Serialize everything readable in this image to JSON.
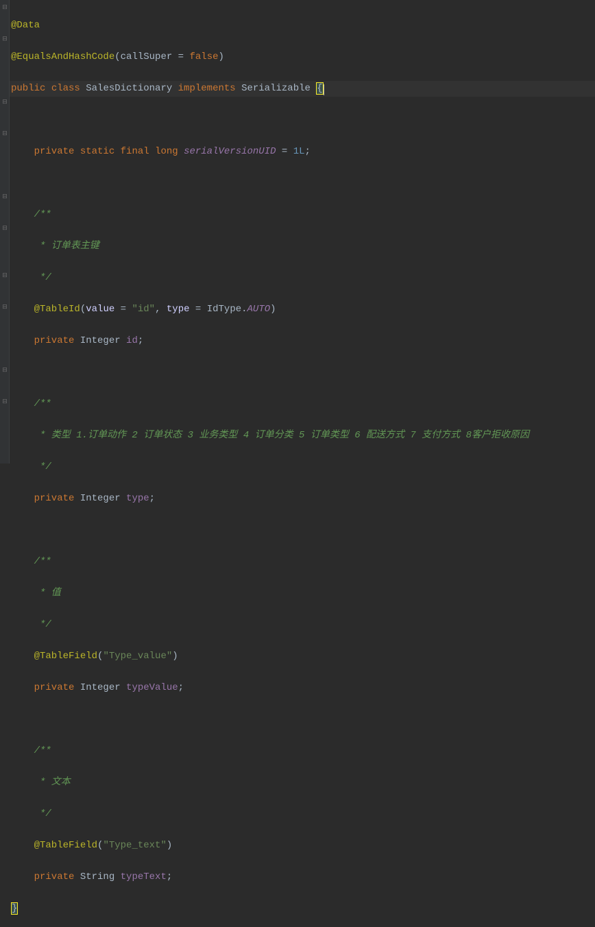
{
  "code": {
    "line1_annotation": "@Data",
    "line2_annotation": "@EqualsAndHashCode",
    "line2_paren_open": "(",
    "line2_attr": "callSuper",
    "line2_eq": " = ",
    "line2_val": "false",
    "line2_paren_close": ")",
    "line3_public": "public ",
    "line3_class": "class ",
    "line3_name": "SalesDictionary ",
    "line3_implements": "implements ",
    "line3_iface": "Serializable ",
    "line3_brace": "{",
    "line5_private": "    private ",
    "line5_static": "static ",
    "line5_final": "final ",
    "line5_long": "long ",
    "line5_field": "serialVersionUID",
    "line5_eq": " = ",
    "line5_val": "1L",
    "line5_semi": ";",
    "line7_doc_open": "    /**",
    "line8_doc": "     * 订单表主键",
    "line9_doc_close": "     */",
    "line10_ann": "    @TableId",
    "line10_paren_open": "(",
    "line10_attr1": "value",
    "line10_eq1": " = ",
    "line10_str": "\"id\"",
    "line10_comma": ", ",
    "line10_attr2": "type",
    "line10_eq2": " = ",
    "line10_idtype": "IdType.",
    "line10_auto": "AUTO",
    "line10_paren_close": ")",
    "line11_private": "    private ",
    "line11_type": "Integer ",
    "line11_name": "id",
    "line11_semi": ";",
    "line13_doc_open": "    /**",
    "line14_doc": "     * 类型 1.订单动作 2 订单状态 3 业务类型 4 订单分类 5 订单类型 6 配送方式 7 支付方式 8客户拒收原因",
    "line15_doc_close": "     */",
    "line16_private": "    private ",
    "line16_type": "Integer ",
    "line16_name": "type",
    "line16_semi": ";",
    "line18_doc_open": "    /**",
    "line19_doc": "     * 值",
    "line20_doc_close": "     */",
    "line21_ann": "    @TableField",
    "line21_paren_open": "(",
    "line21_str": "\"Type_value\"",
    "line21_paren_close": ")",
    "line22_private": "    private ",
    "line22_type": "Integer ",
    "line22_name": "typeValue",
    "line22_semi": ";",
    "line24_doc_open": "    /**",
    "line25_doc": "     * 文本",
    "line26_doc_close": "     */",
    "line27_ann": "    @TableField",
    "line27_paren_open": "(",
    "line27_str": "\"Type_text\"",
    "line27_paren_close": ")",
    "line28_private": "    private ",
    "line28_type": "String ",
    "line28_name": "typeText",
    "line28_semi": ";",
    "line29_brace": "}"
  }
}
